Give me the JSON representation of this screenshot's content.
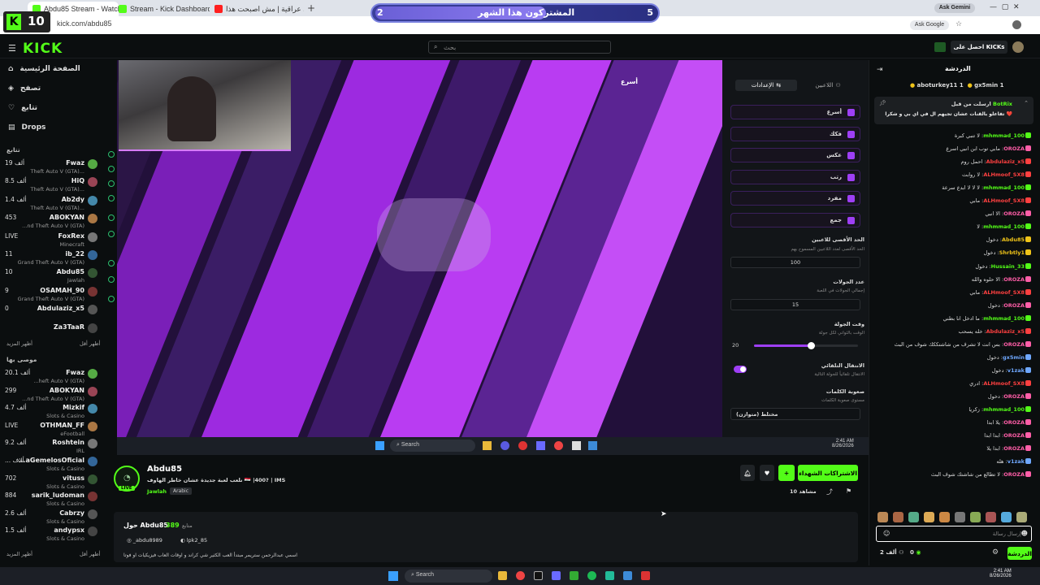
{
  "browser": {
    "tabs": [
      {
        "label": "Abdu85 Stream - Watch Live o",
        "active": true
      },
      {
        "label": "Stream - Kick Dashboard",
        "active": false
      },
      {
        "label": "اغاني عراقية | مش اصبحت هذا",
        "active": false
      }
    ],
    "new_tab": "+",
    "url": "kick.com/abdu85",
    "ask_gemini": "Ask Gemini",
    "ask_google": "Ask Google",
    "overlay_badge": "10"
  },
  "sub_goal": {
    "left": "2",
    "label": "المشتركون هذا الشهر",
    "right": "5",
    "progress": 0.6
  },
  "site": {
    "logo": "KICK",
    "search_placeholder": "بحث",
    "get_kicks": "احصل على KICKs",
    "nav": [
      {
        "label": "الصفحة الرئيسية",
        "icon": "home-icon"
      },
      {
        "label": "تصفح",
        "icon": "compass-icon"
      },
      {
        "label": "تتابع",
        "icon": "heart-icon"
      },
      {
        "label": "Drops",
        "icon": "drops-icon"
      }
    ],
    "following_header": "تتابع",
    "following": [
      {
        "views": "19 ألف",
        "name": "Fwaz",
        "cat": "Theft Auto V (GTA)..."
      },
      {
        "views": "8.5 ألف",
        "name": "HiQ",
        "cat": "Theft Auto V (GTA)..."
      },
      {
        "views": "1.4 ألف",
        "name": "Ab2dy",
        "cat": "Theft Auto V (GTA)..."
      },
      {
        "views": "453",
        "name": "ABOKYAN",
        "cat": "...nd Theft Auto V (GTA)"
      },
      {
        "views": "LIVE",
        "name": "FoxRex",
        "cat": "Minecraft"
      },
      {
        "views": "11",
        "name": "ib_22",
        "cat": "Grand Theft Auto V (GTA)"
      },
      {
        "views": "10",
        "name": "Abdu85",
        "cat": "Jawlah"
      },
      {
        "views": "9",
        "name": "OSAMAH_90",
        "cat": "Grand Theft Auto V (GTA)"
      },
      {
        "views": "0",
        "name": "Abdulaziz_x5",
        "cat": ""
      },
      {
        "views": "",
        "name": "Za3TaaR",
        "cat": ""
      }
    ],
    "show_more_1": "أظهر المزيد",
    "show_less_1": "أظهر أقل",
    "recommended_header": "موصى بها",
    "recommended": [
      {
        "views": "20.1 ألف",
        "name": "Fwaz",
        "cat": "...heft Auto V (GTA)"
      },
      {
        "views": "299",
        "name": "ABOKYAN",
        "cat": "...nd Theft Auto V (GTA)"
      },
      {
        "views": "4.7 ألف",
        "name": "Mizkif",
        "cat": "Slots & Casino"
      },
      {
        "views": "LIVE",
        "name": "OTHMAN_FF",
        "cat": "eFootball"
      },
      {
        "views": "9.2 ألف",
        "name": "Roshtein",
        "cat": "IRL"
      },
      {
        "views": "... ألاف",
        "name": "...aGemelosOficial",
        "cat": "Slots & Casino"
      },
      {
        "views": "702",
        "name": "vituss",
        "cat": "Slots & Casino"
      },
      {
        "views": "884",
        "name": "sarik_ludoman",
        "cat": "Slots & Casino"
      },
      {
        "views": "2.6 ألف",
        "name": "Cabrzy",
        "cat": "Slots & Casino"
      },
      {
        "views": "1.5 ألف",
        "name": "andypsx",
        "cat": "Slots & Casino"
      }
    ],
    "show_more_2": "أظهر المزيد",
    "show_less_2": "أظهر أقل"
  },
  "game_panel": {
    "tab_players": "اللاعبين",
    "tab_settings": "الإعدادات",
    "stream_tag": "أسرع",
    "checks": [
      "أسرع",
      "فكك",
      "عكس",
      "رتب",
      "مفرد",
      "جمع"
    ],
    "max_players_label": "الحد الأقصى للاعبين",
    "max_players_sub": "الحد الأقصى لعدد اللاعبين المسموح بهم",
    "max_players": "100",
    "rounds_label": "عدد الجولات",
    "rounds_sub": "إجمالي الجولات في اللعبة",
    "rounds": "15",
    "round_time_label": "وقت الجولة",
    "round_time_sub": "الوقت بالثواني لكل جولة",
    "round_time": "20",
    "round_time_fraction": 0.55,
    "auto_next_label": "الانتقال التلقائي",
    "auto_next_sub": "الانتقال تلقائياً للجولة التالية",
    "difficulty_label": "صعوبة الكلمات",
    "difficulty_sub": "مستوى صعوبة الكلمات",
    "difficulty": "مختلط (متوازن)"
  },
  "stream_taskbar": {
    "search": "Search",
    "time": "2:41 AM",
    "date": "8/26/2026"
  },
  "stream_info": {
    "channel": "Abdu85",
    "live_badge": "LIVE",
    "title": "نلعب لعبة جديدة عشان خاطر الهاوف 🇮🇶 |400? | IMS",
    "category": "Jawlah",
    "language": "Arabic",
    "subscribe": "الاشتراكات الشهداء",
    "viewers": "10 مشاهد",
    "about_title": "حول Abdu85",
    "followers_count": "389",
    "followers_label": "متابع",
    "instagram": "_abdu8989",
    "discord": "lpk2_85",
    "bio": "اسمي عبدالرحمن ستريمر مبتدأ العب الكثير شي كراند و اوقات العاب فيزيكيات او فوتا"
  },
  "chat": {
    "title": "الدردشة",
    "top_gifters": [
      {
        "name": "aboturkey11",
        "count": "1"
      },
      {
        "name": "gx5min",
        "count": "1"
      }
    ],
    "pinned_user": "BotRix",
    "pinned_line1": "ارسلت من قبل",
    "pinned_line2": "تفاعلو بالقنات عشان تجيهم ال في اي بي و شكرا ❤️",
    "messages": [
      {
        "user": "mhmmad_100",
        "color": "#53fc18",
        "text": "لا تنبي كبرة"
      },
      {
        "user": "OROZA",
        "color": "#ff5ea8",
        "text": "مابي توب ابن انبي اسرع"
      },
      {
        "user": "Abdulaziz_x5",
        "color": "#ff4040",
        "text": "احمل روم"
      },
      {
        "user": "ALHmoof_SX8",
        "color": "#ff4040",
        "text": "لا روابت"
      },
      {
        "user": "mhmmad_100",
        "color": "#53fc18",
        "text": "لا لا لا ابدع سرعة"
      },
      {
        "user": "ALHmoof_SX8",
        "color": "#ff4040",
        "text": "مابي"
      },
      {
        "user": "OROZA",
        "color": "#ff5ea8",
        "text": "الا انبي"
      },
      {
        "user": "mhmmad_100",
        "color": "#53fc18",
        "text": "لا"
      },
      {
        "user": "Abdu85",
        "color": "#f0c419",
        "text": "دخول"
      },
      {
        "user": "Shrbtly1",
        "color": "#f0c419",
        "text": "دخول"
      },
      {
        "user": "Hussain_33",
        "color": "#53fc18",
        "text": "دخول"
      },
      {
        "user": "OROZA",
        "color": "#ff5ea8",
        "text": "الا حلوه والله"
      },
      {
        "user": "ALHmoof_SX8",
        "color": "#ff4040",
        "text": "مابي"
      },
      {
        "user": "OROZA",
        "color": "#ff5ea8",
        "text": "دخول"
      },
      {
        "user": "mhmmad_100",
        "color": "#53fc18",
        "text": "ما ادخل انا بطني"
      },
      {
        "user": "Abdulaziz_x5",
        "color": "#ff4040",
        "text": "خله يسحب"
      },
      {
        "user": "OROZA",
        "color": "#ff5ea8",
        "text": "بس انت لا تشرف من شاشتككك شوف من البث"
      },
      {
        "user": "gx5min",
        "color": "#6fa8ff",
        "text": "دخول"
      },
      {
        "user": "v1zak",
        "color": "#6fa8ff",
        "text": "دخول"
      },
      {
        "user": "ALHmoof_SX8",
        "color": "#ff4040",
        "text": "ادري"
      },
      {
        "user": "OROZA",
        "color": "#ff5ea8",
        "text": "دخول"
      },
      {
        "user": "mhmmad_100",
        "color": "#53fc18",
        "text": "زكريا"
      },
      {
        "user": "OROZA",
        "color": "#ff5ea8",
        "text": "يلا ابدا"
      },
      {
        "user": "OROZA",
        "color": "#ff5ea8",
        "text": "ابدا ابدا"
      },
      {
        "user": "OROZA",
        "color": "#ff5ea8",
        "text": "ابدا يلا"
      },
      {
        "user": "v1zak",
        "color": "#6fa8ff",
        "text": "هله"
      },
      {
        "user": "OROZA",
        "color": "#ff5ea8",
        "text": "لا تطالع من شاشتك شوف البث"
      }
    ],
    "input_placeholder": "إرسال رسالة",
    "send_label": "الدردشة",
    "kicks_count": "0",
    "viewers_count": "2 ألف"
  },
  "os_taskbar": {
    "search": "Search",
    "time": "2:41 AM",
    "date": "8/26/2026"
  },
  "colors": {
    "kick_green": "#53fc18",
    "purple": "#9e3ff5"
  }
}
